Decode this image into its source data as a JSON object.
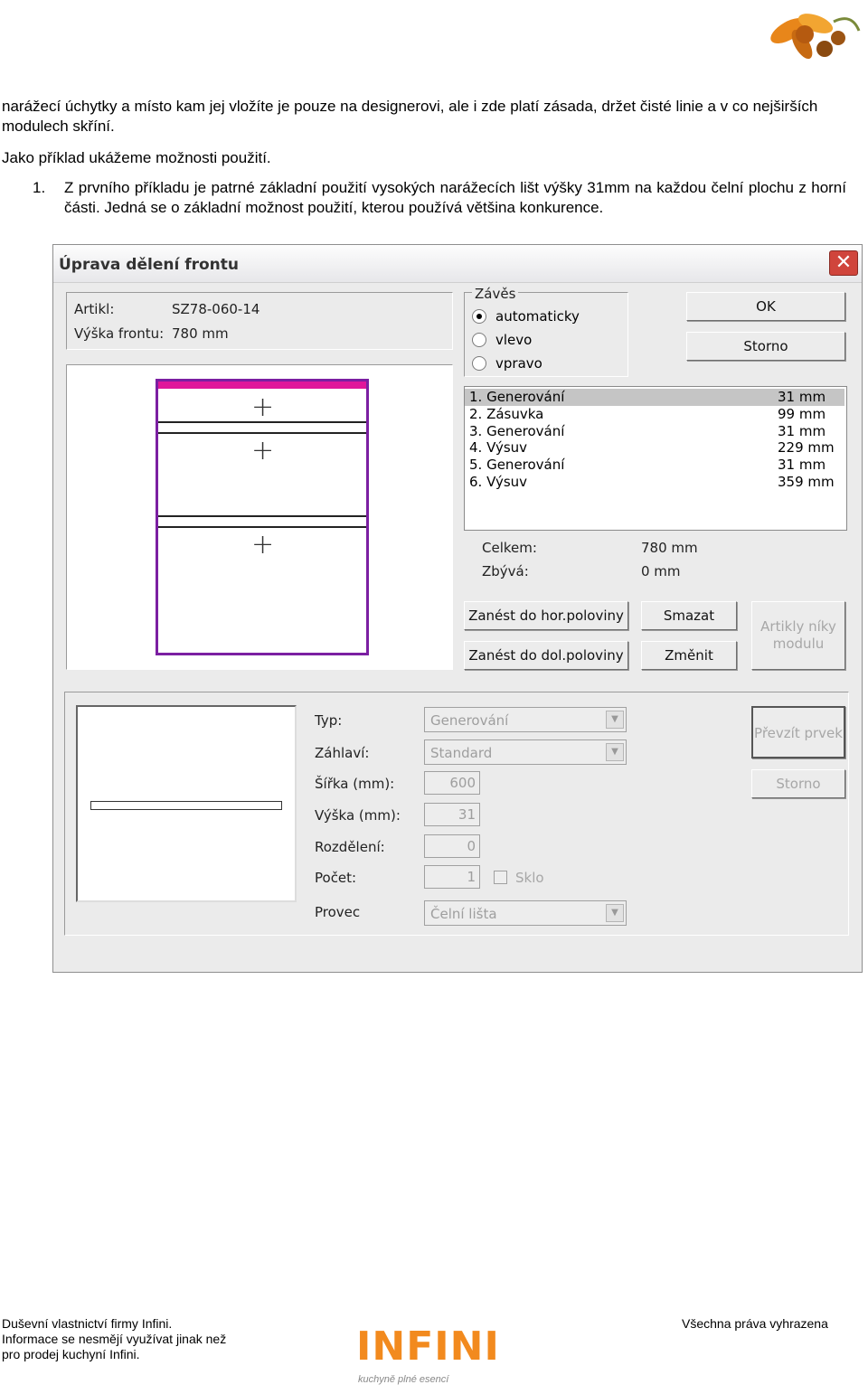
{
  "document": {
    "para1": "narážecí úchytky a místo kam jej vložíte je pouze na designerovi, ale i zde platí zásada, držet čisté linie a v co nejširších modulech skříní.",
    "para2": "Jako příklad ukážeme možnosti použití.",
    "item1_number": "1.",
    "item1_text": "Z prvního příkladu je patrné základní použití vysokých narážecích lišt výšky 31mm na každou čelní plochu z horní části. Jedná se o základní možnost použití, kterou používá většina konkurence."
  },
  "dialog": {
    "title": "Úprava dělení frontu",
    "close_label": "✕",
    "artikl_label": "Artikl:",
    "artikl_value": "SZ78-060-14",
    "vyska_label": "Výška frontu:",
    "vyska_value": "780 mm",
    "zaves_label": "Závěs",
    "radio_options": [
      "automaticky",
      "vlevo",
      "vpravo"
    ],
    "radio_selected": "automaticky",
    "ok_label": "OK",
    "storno_label": "Storno",
    "list_items": [
      {
        "name": "1. Generování",
        "value": "31 mm"
      },
      {
        "name": "2. Zásuvka",
        "value": "99 mm"
      },
      {
        "name": "3. Generování",
        "value": "31 mm"
      },
      {
        "name": "4. Výsuv",
        "value": "229 mm"
      },
      {
        "name": "5. Generování",
        "value": "31 mm"
      },
      {
        "name": "6. Výsuv",
        "value": "359 mm"
      }
    ],
    "celkem_label": "Celkem:",
    "celkem_value": "780 mm",
    "zbyva_label": "Zbývá:",
    "zbyva_value": "0 mm",
    "btn_zanest_hor": "Zanést do hor.poloviny",
    "btn_zanest_dol": "Zanést do dol.poloviny",
    "btn_smazat": "Smazat",
    "btn_zmenit": "Změnit",
    "btn_artikly_1": "Artikly níky",
    "btn_artikly_2": "modulu",
    "typ_label": "Typ:",
    "typ_value": "Generování",
    "zahlavi_label": "Záhlaví:",
    "zahlavi_value": "Standard",
    "sirka_label": "Šířka (mm):",
    "sirka_value": "600",
    "vyska_mm_label": "Výška (mm):",
    "vyska_mm_value": "31",
    "rozdeleni_label": "Rozdělení:",
    "rozdeleni_value": "0",
    "pocet_label": "Počet:",
    "pocet_value": "1",
    "sklo_label": "Sklo",
    "provec_label": "Provec",
    "provec_value": "Čelní lišta",
    "btn_prevzit": "Převzít prvek",
    "btn_storno2": "Storno"
  },
  "footer": {
    "line1": "Duševní vlastnictví firmy Infini.",
    "line2": "Informace se nesmějí využívat jinak než",
    "line3": "pro prodej kuchyní Infini.",
    "rights": "Všechna práva vyhrazena",
    "logo_text": "INFINI",
    "logo_tagline": "kuchyně plné esencí"
  }
}
